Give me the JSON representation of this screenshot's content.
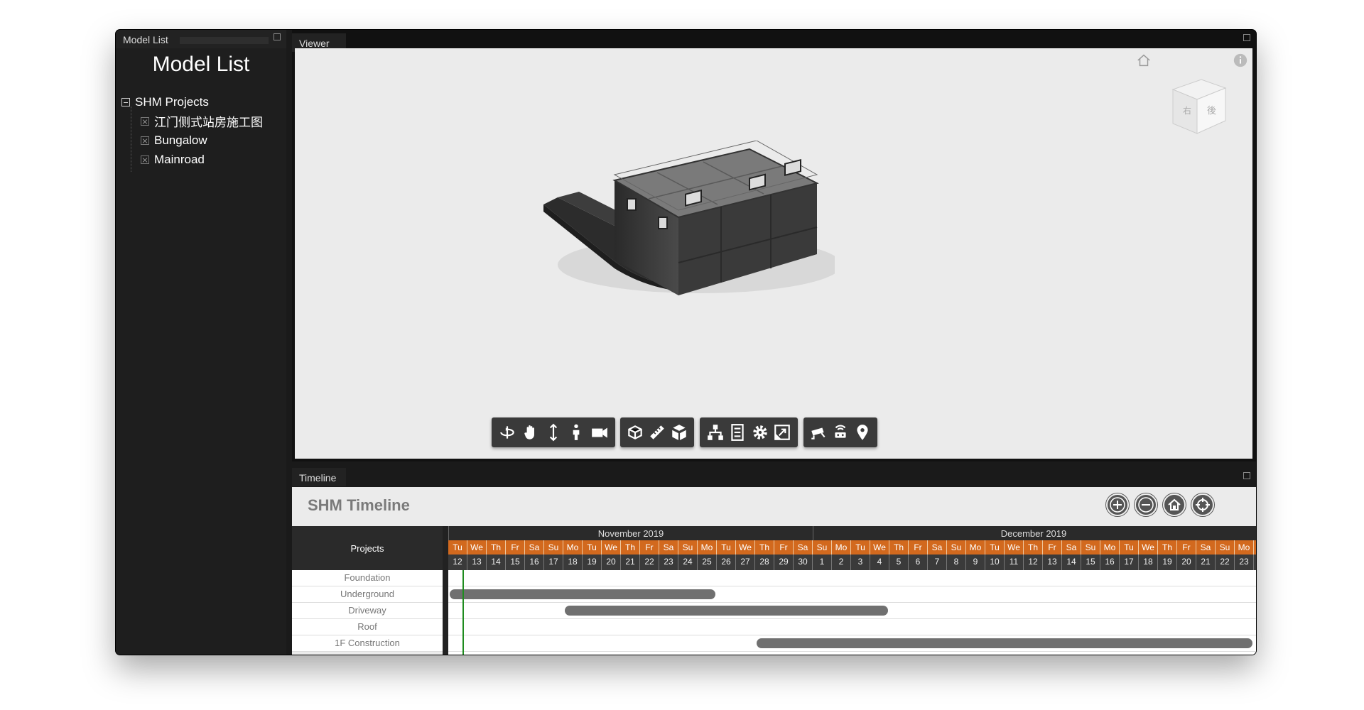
{
  "model_list": {
    "tab_label": "Model List",
    "title": "Model List",
    "root": "SHM Projects",
    "items": [
      "江门侧式站房施工图",
      "Bungalow",
      "Mainroad"
    ]
  },
  "viewer": {
    "tab_label": "Viewer",
    "toolbar_groups": [
      [
        "orbit-icon",
        "pan-icon",
        "dolly-icon",
        "first-person-icon",
        "camera-icon"
      ],
      [
        "section-icon",
        "measure-icon",
        "explode-icon"
      ],
      [
        "model-browser-icon",
        "properties-icon",
        "settings-icon",
        "fullscreen-icon"
      ],
      [
        "cctv-icon",
        "sensor-icon",
        "location-pin-icon"
      ]
    ]
  },
  "timeline": {
    "tab_label": "Timeline",
    "title": "SHM Timeline",
    "controls": [
      "zoom-in-icon",
      "zoom-out-icon",
      "home-icon",
      "target-icon"
    ],
    "projects_header": "Projects",
    "months": [
      {
        "label": "November 2019",
        "days": 19
      },
      {
        "label": "December 2019",
        "days": 23
      }
    ],
    "weekdays": [
      "Tu",
      "We",
      "Th",
      "Fr",
      "Sa",
      "Su",
      "Mo",
      "Tu",
      "We",
      "Th",
      "Fr",
      "Sa",
      "Su",
      "Mo",
      "Tu",
      "We",
      "Th",
      "Fr",
      "Sa",
      "Su",
      "Mo",
      "Tu",
      "We",
      "Th",
      "Fr",
      "Sa",
      "Su",
      "Mo",
      "Tu",
      "We",
      "Th",
      "Fr",
      "Sa",
      "Su",
      "Mo",
      "Tu",
      "We",
      "Th",
      "Fr",
      "Sa",
      "Su",
      "Mo"
    ],
    "dates": [
      "12",
      "13",
      "14",
      "15",
      "16",
      "17",
      "18",
      "19",
      "20",
      "21",
      "22",
      "23",
      "24",
      "25",
      "26",
      "27",
      "28",
      "29",
      "30",
      "1",
      "2",
      "3",
      "4",
      "5",
      "6",
      "7",
      "8",
      "9",
      "10",
      "11",
      "12",
      "13",
      "14",
      "15",
      "16",
      "17",
      "18",
      "19",
      "20",
      "21",
      "22",
      "23"
    ],
    "rows": [
      {
        "label": "Foundation",
        "start": null,
        "end": null
      },
      {
        "label": "Underground",
        "start": "2019-11-12",
        "end": "2019-11-25"
      },
      {
        "label": "Driveway",
        "start": "2019-11-18",
        "end": "2019-12-04"
      },
      {
        "label": "Roof",
        "start": null,
        "end": null
      },
      {
        "label": "1F Construction",
        "start": "2019-11-28",
        "end": "2019-12-23"
      }
    ],
    "today": "2019-11-12"
  }
}
